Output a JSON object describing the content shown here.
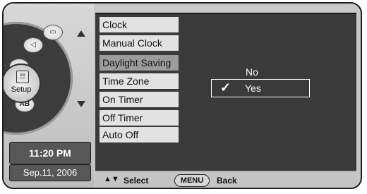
{
  "left_panel": {
    "setup_label": "Setup",
    "ab_label": "AB",
    "time": "11:20 PM",
    "date": "Sep.11, 2006"
  },
  "menu": {
    "items": [
      {
        "label": "Clock"
      },
      {
        "label": "Manual Clock"
      },
      {
        "label": "Daylight Saving"
      },
      {
        "label": "Time Zone"
      },
      {
        "label": "On Timer"
      },
      {
        "label": "Off Timer"
      },
      {
        "label": "Auto Off"
      }
    ],
    "selected": "Daylight Saving"
  },
  "options": {
    "no_label": "No",
    "yes_label": "Yes",
    "checkmark": "✓",
    "selected": "Yes"
  },
  "bottom_bar": {
    "arrows": "▲▼",
    "select_label": "Select",
    "menu_button": "MENU",
    "back_label": "Back"
  }
}
